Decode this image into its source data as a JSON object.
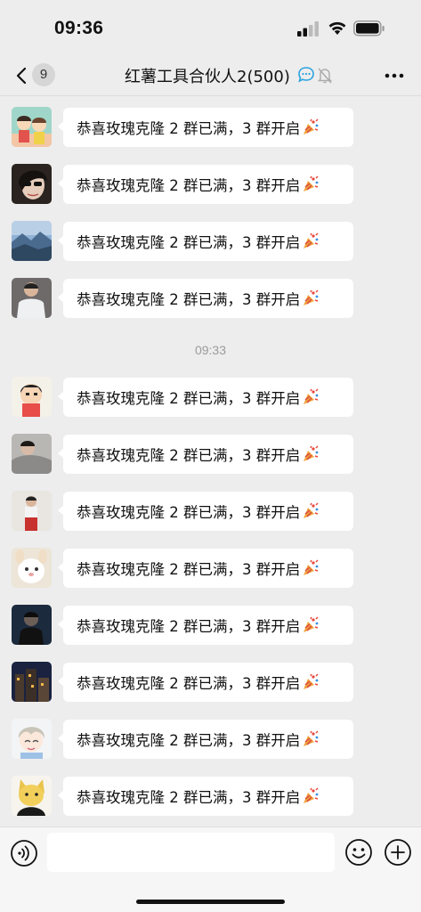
{
  "status_bar": {
    "time": "09:36",
    "signal_icon": "cellular-signal-icon",
    "wifi_icon": "wifi-icon",
    "battery_icon": "battery-icon"
  },
  "nav": {
    "unread_count": "9",
    "title": "红薯工具合伙人2(500)",
    "back_icon": "chevron-left-icon",
    "more_icon": "more-dots-icon",
    "extra_icons": [
      "chat-bubble-icon",
      "mute-bell-icon"
    ]
  },
  "messages_before": [
    {
      "text": "恭喜玫瑰克隆 2 群已满，3 群开启",
      "avatar": "cartoon-couple"
    },
    {
      "text": "恭喜玫瑰克隆 2 群已满，3 群开启",
      "avatar": "sunglasses-person"
    },
    {
      "text": "恭喜玫瑰克隆 2 群已满，3 群开启",
      "avatar": "mountain-landscape"
    },
    {
      "text": "恭喜玫瑰克隆 2 群已满，3 群开启",
      "avatar": "person-white-shirt"
    }
  ],
  "time_divider": "09:33",
  "messages_after": [
    {
      "text": "恭喜玫瑰克隆 2 群已满，3 群开启",
      "avatar": "crayon-cartoon"
    },
    {
      "text": "恭喜玫瑰克隆 2 群已满，3 群开启",
      "avatar": "person-lying"
    },
    {
      "text": "恭喜玫瑰克隆 2 群已满，3 群开启",
      "avatar": "person-red-outfit"
    },
    {
      "text": "恭喜玫瑰克隆 2 群已满，3 群开启",
      "avatar": "white-plush-toy"
    },
    {
      "text": "恭喜玫瑰克隆 2 群已满，3 群开启",
      "avatar": "dark-portrait"
    },
    {
      "text": "恭喜玫瑰克隆 2 群已满，3 群开启",
      "avatar": "city-night"
    },
    {
      "text": "恭喜玫瑰克隆 2 群已满，3 群开启",
      "avatar": "anime-boy"
    },
    {
      "text": "恭喜玫瑰克隆 2 群已满，3 群开启",
      "avatar": "black-cat-cartoon"
    }
  ],
  "message_emoji_icon": "party-popper-icon",
  "input_bar": {
    "placeholder": "",
    "value": "",
    "voice_icon": "voice-icon",
    "emoji_icon": "smiley-icon",
    "plus_icon": "plus-circle-icon"
  }
}
